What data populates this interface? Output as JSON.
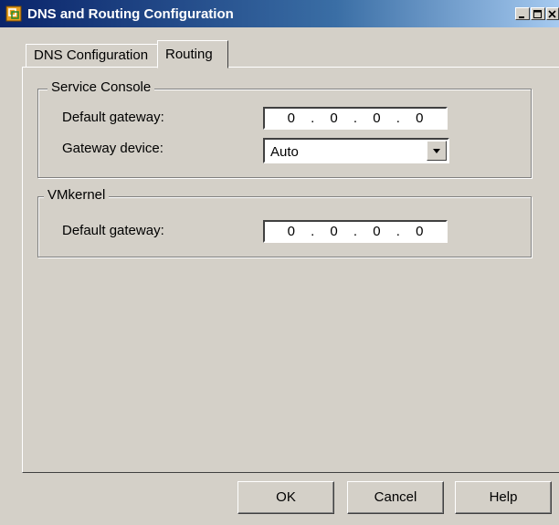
{
  "window": {
    "title": "DNS and Routing Configuration",
    "icon": "vmware-app-icon"
  },
  "tabs": [
    {
      "label": "DNS Configuration",
      "selected": false
    },
    {
      "label": "Routing",
      "selected": true
    }
  ],
  "service_console": {
    "legend": "Service Console",
    "default_gateway_label": "Default gateway:",
    "default_gateway_octets": [
      "0",
      "0",
      "0",
      "0"
    ],
    "gateway_device_label": "Gateway device:",
    "gateway_device_value": "Auto"
  },
  "vmkernel": {
    "legend": "VMkernel",
    "default_gateway_label": "Default gateway:",
    "default_gateway_octets": [
      "0",
      "0",
      "0",
      "0"
    ]
  },
  "buttons": {
    "ok": "OK",
    "cancel": "Cancel",
    "help": "Help"
  }
}
